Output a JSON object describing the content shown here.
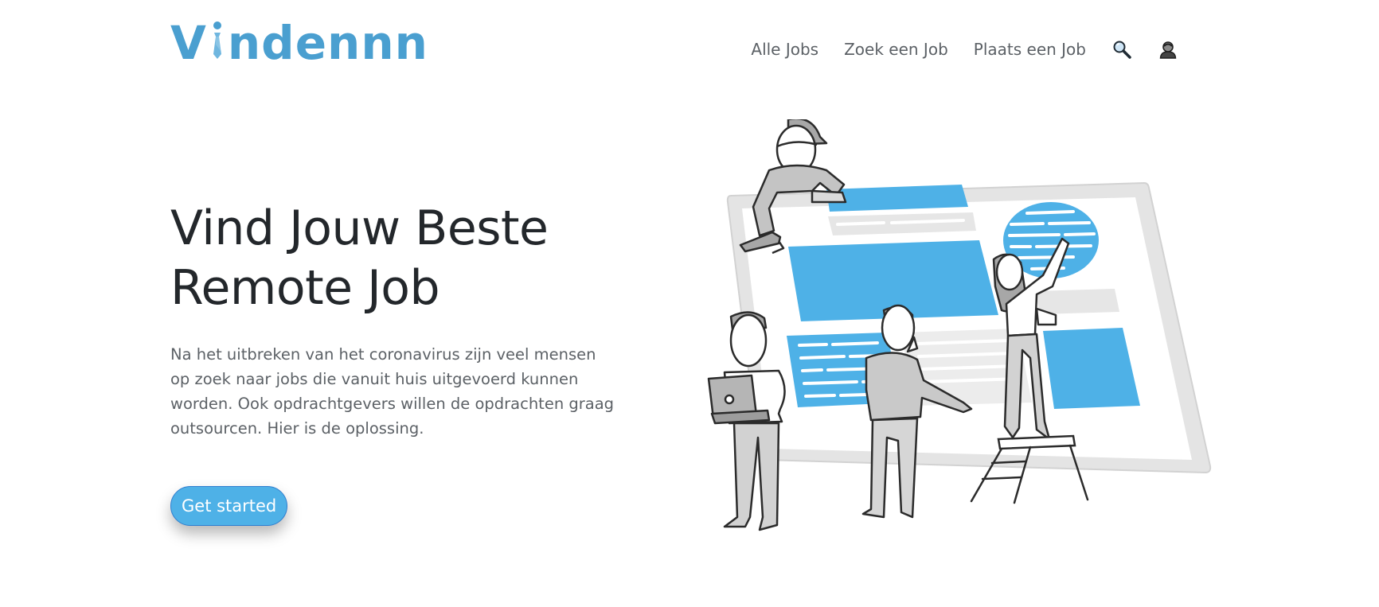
{
  "brand": {
    "name": "Vindennn",
    "prefix": "V",
    "suffix": "ndennn",
    "color": "#4a9fd0"
  },
  "nav": {
    "items": [
      {
        "label": "Alle Jobs"
      },
      {
        "label": "Zoek een Job"
      },
      {
        "label": "Plaats een Job"
      }
    ],
    "search_icon": "magnifying-glass-icon",
    "account_icon": "user-avatar-icon"
  },
  "hero": {
    "title_line1": "Vind Jouw Beste",
    "title_line2": "Remote Job",
    "description": "Na het uitbreken van het coronavirus zijn veel mensen op zoek naar jobs die vanuit huis uitgevoerd kunnen worden. Ook opdrachtgevers willen de opdrachten graag outsourcen. Hier is de oplossing.",
    "cta_label": "Get started"
  },
  "colors": {
    "accent": "#4eb1e7",
    "text": "#23272b",
    "muted": "#5c6166",
    "illustration_gray": "#d9d9d9"
  }
}
